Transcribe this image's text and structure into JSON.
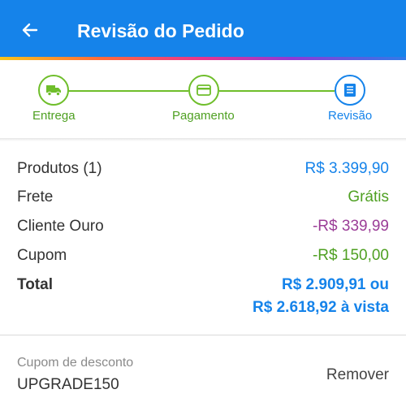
{
  "header": {
    "title": "Revisão do Pedido",
    "back_icon": "arrow-left-icon",
    "background": "#1583ea"
  },
  "stepper": {
    "steps": [
      {
        "label": "Entrega",
        "icon": "truck-icon",
        "state": "done"
      },
      {
        "label": "Pagamento",
        "icon": "credit-card-icon",
        "state": "done"
      },
      {
        "label": "Revisão",
        "icon": "receipt-icon",
        "state": "active"
      }
    ],
    "done_color": "#6fbe2b",
    "active_color": "#1583ea"
  },
  "summary": {
    "rows": [
      {
        "label": "Produtos (1)",
        "value": "R$ 3.399,90",
        "color": "#1583ea"
      },
      {
        "label": "Frete",
        "value": "Grátis",
        "color": "#4fa022"
      },
      {
        "label": "Cliente Ouro",
        "value": "-R$ 339,99",
        "color": "#9b3d97"
      },
      {
        "label": "Cupom",
        "value": "-R$ 150,00",
        "color": "#4fa022"
      }
    ],
    "total": {
      "label": "Total",
      "value_line1": "R$ 2.909,91 ou",
      "value_line2": "R$ 2.618,92 à vista"
    }
  },
  "coupon": {
    "caption": "Cupom de desconto",
    "code": "UPGRADE150",
    "remove_label": "Remover"
  }
}
